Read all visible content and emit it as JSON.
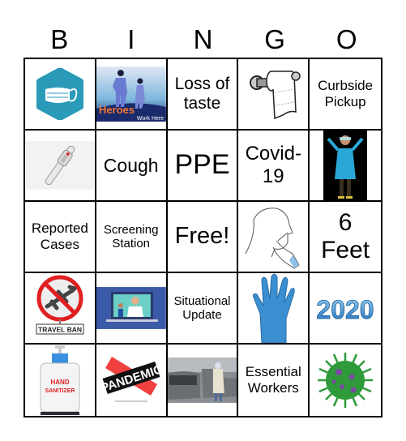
{
  "header": {
    "letters": [
      "B",
      "I",
      "N",
      "G",
      "O"
    ]
  },
  "cells": [
    {
      "type": "image",
      "icon": "face-mask-icon"
    },
    {
      "type": "image",
      "icon": "heroes-work-here-image",
      "caption": "Heroes",
      "subcaption": "Work Here"
    },
    {
      "type": "text",
      "label": "Loss of taste"
    },
    {
      "type": "image",
      "icon": "toilet-paper-icon"
    },
    {
      "type": "text",
      "label": "Curbside Pickup"
    },
    {
      "type": "image",
      "icon": "thermometer-icon"
    },
    {
      "type": "text",
      "label": "Cough"
    },
    {
      "type": "text",
      "label": "PPE"
    },
    {
      "type": "text",
      "label": "Covid-19"
    },
    {
      "type": "image",
      "icon": "health-worker-ppe-icon"
    },
    {
      "type": "text",
      "label": "Reported Cases"
    },
    {
      "type": "text",
      "label": "Screening Station"
    },
    {
      "type": "text",
      "label": "Free!",
      "free": true
    },
    {
      "type": "image",
      "icon": "nasal-swab-icon"
    },
    {
      "type": "text",
      "label": "6 Feet"
    },
    {
      "type": "image",
      "icon": "travel-ban-icon",
      "caption": "TRAVEL BAN"
    },
    {
      "type": "image",
      "icon": "telehealth-icon"
    },
    {
      "type": "text",
      "label": "Situational Update"
    },
    {
      "type": "image",
      "icon": "blue-glove-icon"
    },
    {
      "type": "image",
      "icon": "year-2020-icon",
      "caption": "2020"
    },
    {
      "type": "image",
      "icon": "hand-sanitizer-icon",
      "caption": "HAND SANITIZER"
    },
    {
      "type": "image",
      "icon": "pandemic-stamp-icon",
      "caption": "PANDEMIC"
    },
    {
      "type": "image",
      "icon": "drive-through-testing-photo"
    },
    {
      "type": "text",
      "label": "Essential Workers"
    },
    {
      "type": "image",
      "icon": "coronavirus-icon"
    }
  ],
  "colors": {
    "mask_teal": "#2a9ab8",
    "glove_blue": "#3a8fd0",
    "virus_green": "#2e9a3a",
    "ban_red": "#e02020",
    "hero_bg": "#1a2a6a"
  }
}
